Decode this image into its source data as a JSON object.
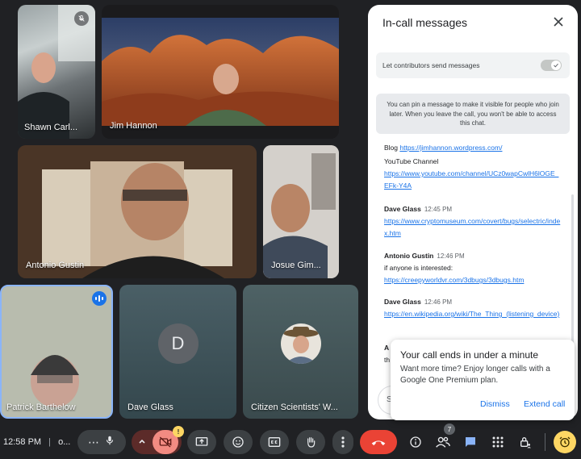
{
  "participants": [
    {
      "name": "Shawn Carl...",
      "muted": true
    },
    {
      "name": "Jim Hannon"
    },
    {
      "name": "Antonio Gustin"
    },
    {
      "name": "Josue Gim..."
    },
    {
      "name": "Patrick Barthelow",
      "speaking": true
    },
    {
      "name": "Dave Glass",
      "initial": "D"
    },
    {
      "name": "Citizen Scientists' W..."
    }
  ],
  "chat": {
    "title": "In-call messages",
    "allow_label": "Let contributors send messages",
    "notice": "You can pin a message to make it visible for people who join later. When you leave the call, you won't be able to access this chat.",
    "messages": [
      {
        "lines": [
          {
            "text": "Blog ",
            "link": "https://jimhannon.wordpress.com/"
          },
          {
            "text": "YouTube Channel"
          },
          {
            "link": "https://www.youtube.com/channel/UCz0wapCwlH6lOGE_EFk-Y4A"
          }
        ]
      },
      {
        "sender": "Dave Glass",
        "time": "12:45 PM",
        "link": "https://www.cryptomuseum.com/covert/bugs/selectric/index.htm"
      },
      {
        "sender": "Antonio Gustin",
        "time": "12:46 PM",
        "text": "if anyone is interested:",
        "link": "https://creepyworldvr.com/3dbugs/3dbugs.htm"
      },
      {
        "sender": "Dave Glass",
        "time": "12:46 PM",
        "link": "https://en.wikipedia.org/wiki/The_Thing_(listening_device)"
      },
      {
        "sender": "A",
        "text": "th"
      }
    ],
    "compose_placeholder": "S"
  },
  "toast": {
    "title": "Your call ends in under a minute",
    "body": "Want more time? Enjoy longer calls with a Google One Premium plan.",
    "dismiss": "Dismiss",
    "extend": "Extend call"
  },
  "toolbar": {
    "time": "12:58 PM",
    "separator": "|",
    "meeting_code": "o...",
    "people_count": "7",
    "camera_warning": "!"
  },
  "colors": {
    "accent": "#1a73e8",
    "end_call": "#ea4335",
    "camera_off": "#f28b82",
    "timer": "#fdd663"
  }
}
